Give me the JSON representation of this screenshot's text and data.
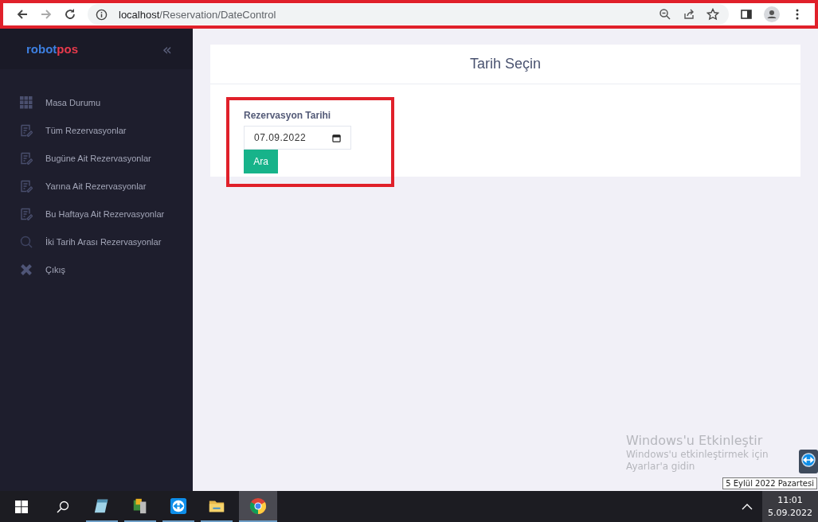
{
  "browser": {
    "url_host": "localhost",
    "url_path": "/Reservation/DateControl"
  },
  "sidebar": {
    "logo_left": "robot",
    "logo_right": "pos",
    "collapse": "«",
    "items": [
      {
        "label": "Masa Durumu"
      },
      {
        "label": "Tüm Rezervasyonlar"
      },
      {
        "label": "Bugüne Ait Rezervasyonlar"
      },
      {
        "label": "Yarına Ait Rezervasyonlar"
      },
      {
        "label": "Bu Haftaya Ait Rezervasyonlar"
      },
      {
        "label": "İki Tarih Arası Rezervasyonlar"
      },
      {
        "label": "Çıkış"
      }
    ]
  },
  "card": {
    "title": "Tarih Seçin",
    "field_label": "Rezervasyon Tarihi",
    "date_value": "07.09.2022",
    "button": "Ara"
  },
  "activation": {
    "title": "Windows'u Etkinleştir",
    "line_1": "Windows'u etkinleştirmek için",
    "line_2": "Ayarlar'a gidin"
  },
  "tooltip": "5 Eylül 2022 Pazartesi",
  "taskbar": {
    "apps": [
      {
        "selected": false
      },
      {
        "selected": false
      },
      {
        "selected": false
      },
      {
        "selected": false
      },
      {
        "selected": true
      }
    ],
    "time": "11:01",
    "date": "5.09.2022"
  }
}
